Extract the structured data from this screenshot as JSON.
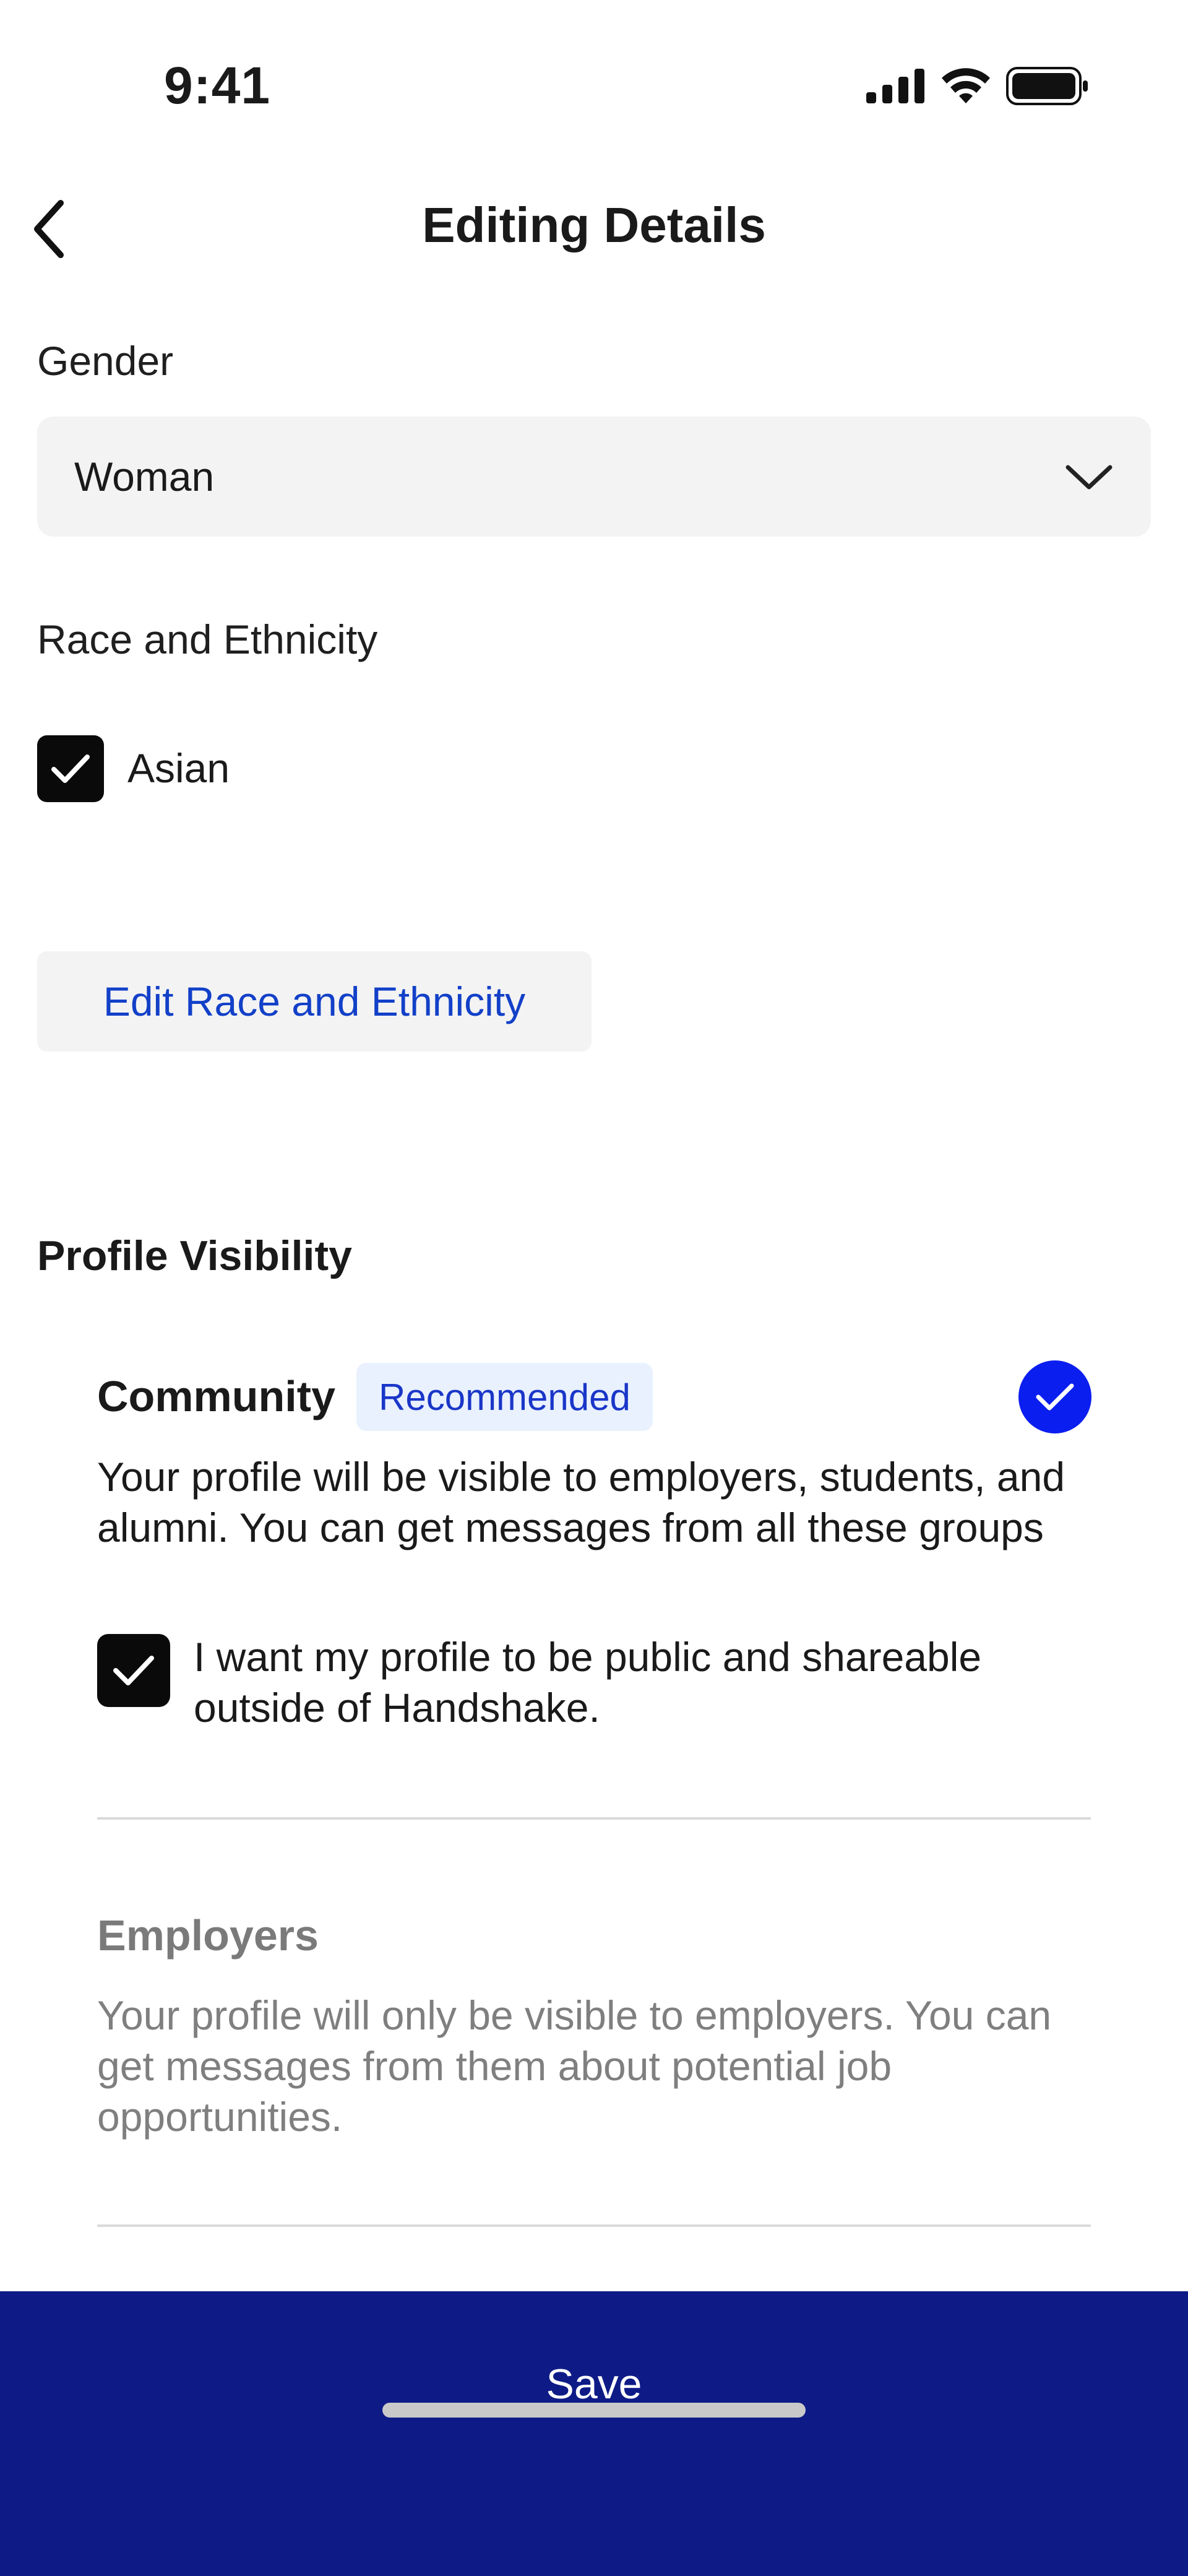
{
  "status_bar": {
    "time": "9:41",
    "icons": [
      "cellular-signal-icon",
      "wifi-icon",
      "battery-icon"
    ]
  },
  "header": {
    "title": "Editing Details",
    "back_icon": "chevron-left-icon"
  },
  "gender": {
    "label": "Gender",
    "selected_value": "Woman",
    "dropdown_icon": "chevron-down-icon"
  },
  "race": {
    "label": "Race and Ethnicity",
    "items": [
      {
        "label": "Asian",
        "checked": true
      }
    ],
    "edit_button_label": "Edit Race and Ethnicity"
  },
  "visibility": {
    "title": "Profile Visibility",
    "options": [
      {
        "title": "Community",
        "badge": "Recommended",
        "selected": true,
        "description": "Your profile will be visible to employers, students, and alumni. You can get messages from all these groups",
        "sub_checkbox": {
          "checked": true,
          "label": "I want my profile to be public and shareable outside of Handshake."
        }
      },
      {
        "title": "Employers",
        "selected": false,
        "description": "Your profile will only be visible to employers. You can get messages from them about potential job opportunities."
      }
    ]
  },
  "footer": {
    "save_label": "Save"
  },
  "colors": {
    "accent_blue": "#0b1ef0",
    "link_blue": "#1240c8",
    "footer_navy": "#0e1b87",
    "badge_bg": "#e9f1ff",
    "field_bg": "#f3f3f3"
  }
}
